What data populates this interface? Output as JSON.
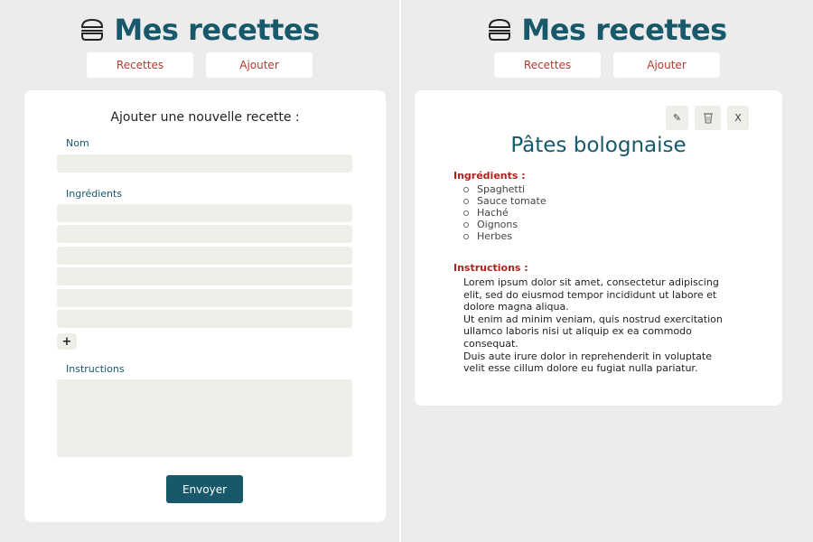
{
  "app": {
    "title": "Mes recettes",
    "icon": "burger-icon",
    "accent_color": "#17586b",
    "link_color": "#b23a2e"
  },
  "nav": {
    "recipes_label": "Recettes",
    "add_label": "Ajouter"
  },
  "form": {
    "heading": "Ajouter une nouvelle recette :",
    "name_label": "Nom",
    "name_value": "",
    "ingredients_label": "Ingrédients",
    "ingredient_values": [
      "",
      "",
      "",
      "",
      "",
      ""
    ],
    "add_ingredient_label": "+",
    "instructions_label": "Instructions",
    "instructions_value": "",
    "submit_label": "Envoyer"
  },
  "recipe": {
    "edit_icon_label": "✎",
    "close_label": "X",
    "title": "Pâtes bolognaise",
    "ingredients_heading": "Ingrédients :",
    "ingredients": [
      "Spaghetti",
      "Sauce tomate",
      "Haché",
      "Oignons",
      "Herbes"
    ],
    "instructions_heading": "Instructions :",
    "instructions": [
      "Lorem ipsum dolor sit amet, consectetur adipiscing elit, sed do eiusmod tempor incididunt ut labore et dolore magna aliqua.",
      "Ut enim ad minim veniam, quis nostrud exercitation ullamco laboris nisi ut aliquip ex ea commodo consequat.",
      "Duis aute irure dolor in reprehenderit in voluptate velit esse cillum dolore eu fugiat nulla pariatur."
    ]
  }
}
